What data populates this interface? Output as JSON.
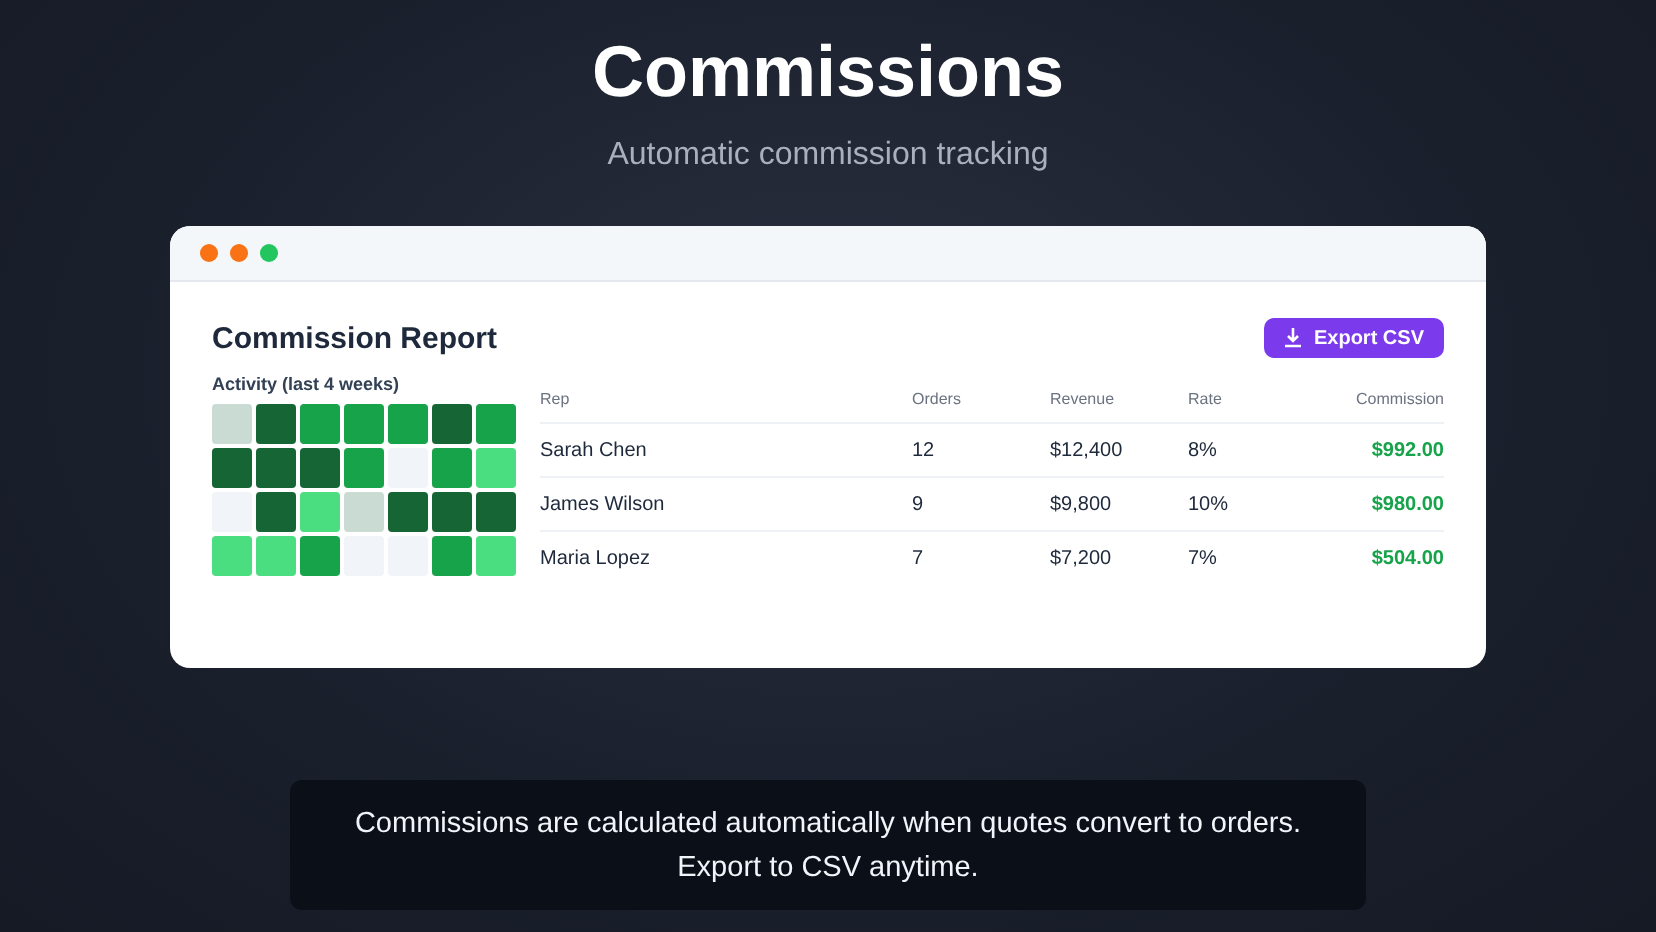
{
  "title": "Commissions",
  "subtitle": "Automatic commission tracking",
  "window": {
    "traffic_lights": [
      {
        "color": "#f97316"
      },
      {
        "color": "#f97316"
      },
      {
        "color": "#22c55e"
      }
    ],
    "report_title": "Commission Report",
    "export_button": "Export CSV",
    "activity": {
      "label": "Activity (last 4 weeks)",
      "rows": [
        {
          "cells": [
            {
              "color": "#c9dbd3"
            },
            {
              "color": "#166534"
            },
            {
              "color": "#16a34a"
            },
            {
              "color": "#16a34a"
            },
            {
              "color": "#16a34a"
            },
            {
              "color": "#166534"
            },
            {
              "color": "#16a34a"
            }
          ]
        },
        {
          "cells": [
            {
              "color": "#166534"
            },
            {
              "color": "#166534"
            },
            {
              "color": "#166534"
            },
            {
              "color": "#16a34a"
            },
            {
              "color": "#f1f5f9"
            },
            {
              "color": "#16a34a"
            },
            {
              "color": "#4ade80"
            }
          ]
        },
        {
          "cells": [
            {
              "color": "#f1f5f9"
            },
            {
              "color": "#166534"
            },
            {
              "color": "#4ade80"
            },
            {
              "color": "#c9dbd3"
            },
            {
              "color": "#166534"
            },
            {
              "color": "#166534"
            },
            {
              "color": "#166534"
            }
          ]
        },
        {
          "cells": [
            {
              "color": "#4ade80"
            },
            {
              "color": "#4ade80"
            },
            {
              "color": "#16a34a"
            },
            {
              "color": "#f1f5f9"
            },
            {
              "color": "#f1f5f9"
            },
            {
              "color": "#16a34a"
            },
            {
              "color": "#4ade80"
            }
          ]
        }
      ]
    },
    "table": {
      "columns": [
        "Rep",
        "Orders",
        "Revenue",
        "Rate",
        "Commission"
      ],
      "rows": [
        [
          "Sarah Chen",
          "12",
          "$12,400",
          "8%",
          "$992.00"
        ],
        [
          "James Wilson",
          "9",
          "$9,800",
          "10%",
          "$980.00"
        ],
        [
          "Maria Lopez",
          "7",
          "$7,200",
          "7%",
          "$504.00"
        ]
      ]
    }
  },
  "caption": [
    "Commissions are calculated automatically when quotes convert to orders.",
    "Export to CSV anytime."
  ]
}
